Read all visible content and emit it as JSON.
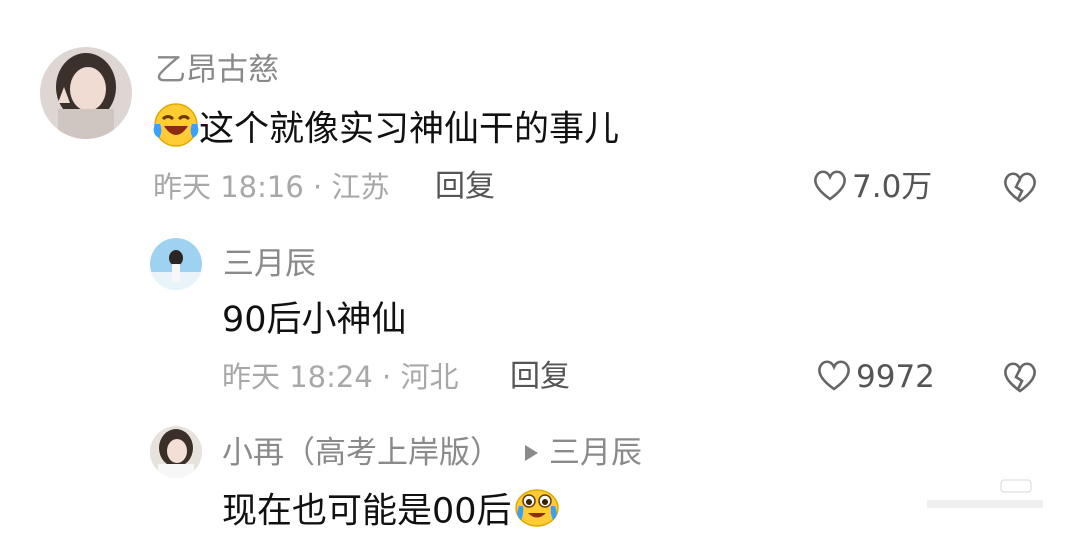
{
  "comments": [
    {
      "author": "乙昂古慈",
      "text": "这个就像实习神仙干的事儿",
      "emoji": "laughing-crying-emoji",
      "time": "昨天 18:16 ·",
      "location": "江苏",
      "reply_label": "回复",
      "likes": "7.0万"
    },
    {
      "author": "三月辰",
      "text": "90后小神仙",
      "time": "昨天 18:24 ·",
      "location": "河北",
      "reply_label": "回复",
      "likes": "9972"
    },
    {
      "author": "小再（高考上岸版）",
      "reply_to": "三月辰",
      "text": "现在也可能是00后",
      "emoji": "crying-laughing-emoji"
    }
  ],
  "colors": {
    "name": "#8a8a8a",
    "text": "#111111",
    "meta": "#a8a8a8"
  }
}
